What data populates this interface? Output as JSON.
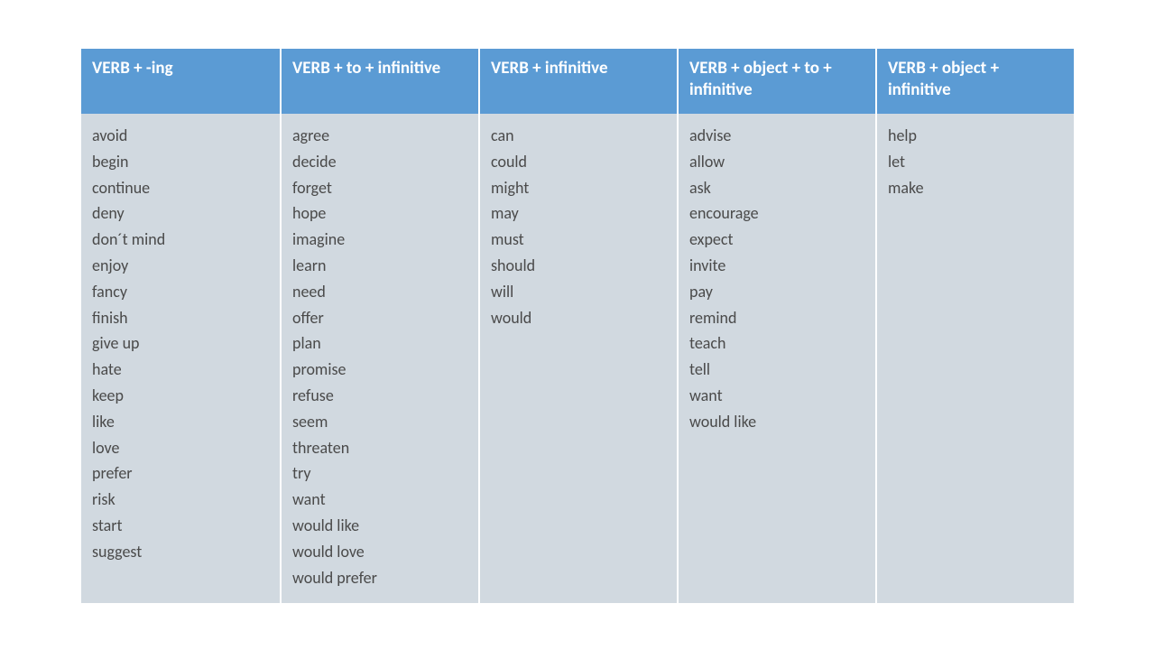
{
  "columns": [
    {
      "header": "VERB + -ing",
      "items": [
        "avoid",
        "begin",
        "continue",
        "deny",
        "don´t mind",
        "enjoy",
        "fancy",
        "finish",
        "give up",
        "hate",
        "keep",
        "like",
        "love",
        "prefer",
        "risk",
        "start",
        "suggest"
      ]
    },
    {
      "header": "VERB + to + infinitive",
      "items": [
        "agree",
        "decide",
        "forget",
        "hope",
        "imagine",
        "learn",
        "need",
        "offer",
        "plan",
        "promise",
        "refuse",
        "seem",
        "threaten",
        "try",
        "want",
        "would like",
        "would love",
        "would prefer"
      ]
    },
    {
      "header": "VERB + infinitive",
      "items": [
        "can",
        "could",
        "might",
        "may",
        "must",
        "should",
        "will",
        "would"
      ]
    },
    {
      "header": "VERB + object + to + infinitive",
      "items": [
        "advise",
        "allow",
        "ask",
        "encourage",
        "expect",
        "invite",
        "pay",
        "remind",
        "teach",
        "tell",
        "want",
        "would like"
      ]
    },
    {
      "header": "VERB + object + infinitive",
      "items": [
        "help",
        "let",
        "make"
      ]
    }
  ]
}
